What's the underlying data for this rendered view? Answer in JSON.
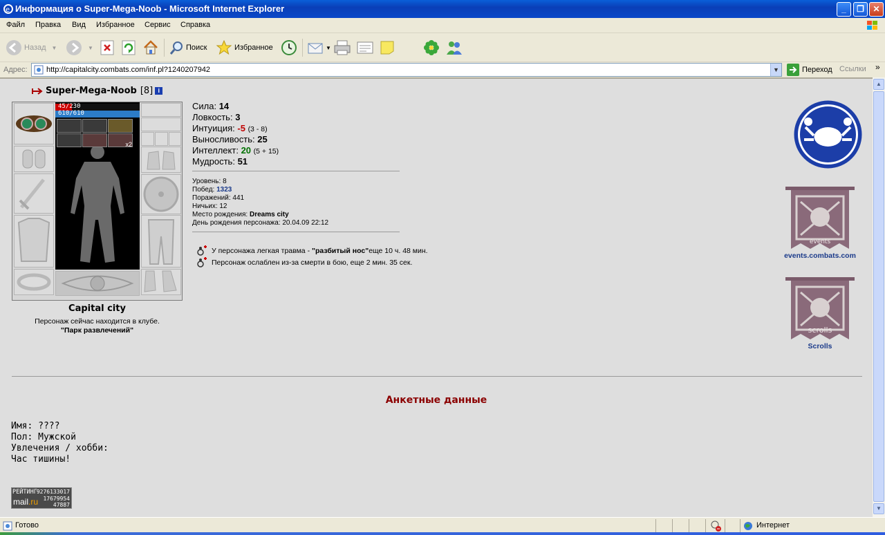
{
  "window": {
    "title": "Информация о Super-Mega-Noob - Microsoft Internet Explorer"
  },
  "menu": [
    "Файл",
    "Правка",
    "Вид",
    "Избранное",
    "Сервис",
    "Справка"
  ],
  "toolbar": {
    "back": "Назад",
    "search": "Поиск",
    "favorites": "Избранное"
  },
  "address": {
    "label": "Адрес:",
    "url": "http://capitalcity.combats.com/inf.pl?1240207942",
    "go": "Переход",
    "links": "Ссылки"
  },
  "character": {
    "name": "Super-Mega-Noob",
    "level": "[8]",
    "hp": "45/230",
    "hp_fraction": 0.196,
    "mp": "610/610",
    "potion_count": "x2",
    "city": "Capital city",
    "club_line": "Персонаж сейчас находится в клубе.",
    "club_name": "\"Парк развлечений\""
  },
  "stats": [
    {
      "label": "Сила:",
      "value": "14",
      "extra": "",
      "tone": ""
    },
    {
      "label": "Ловкость:",
      "value": "3",
      "extra": "",
      "tone": ""
    },
    {
      "label": "Интуиция:",
      "value": "-5",
      "extra": "(3 - 8)",
      "tone": "neg"
    },
    {
      "label": "Выносливость:",
      "value": "25",
      "extra": "",
      "tone": ""
    },
    {
      "label": "Интеллект:",
      "value": "20",
      "extra": "(5 + 15)",
      "tone": "pos"
    },
    {
      "label": "Мудрость:",
      "value": "51",
      "extra": "",
      "tone": ""
    }
  ],
  "records": {
    "level_label": "Уровень:",
    "level": "8",
    "wins_label": "Побед:",
    "wins": "1323",
    "losses_label": "Поражений:",
    "losses": "441",
    "draws_label": "Ничьих:",
    "draws": "12",
    "birthplace_label": "Место рождения:",
    "birthplace": "Dreams city",
    "birthday_label": "День рождения персонажа:",
    "birthday": "20.04.09 22:12"
  },
  "effects": {
    "injury_prefix": "У персонажа легкая травма - ",
    "injury_name": "\"разбитый нос\"",
    "injury_suffix": " еще 10 ч. 48 мин.",
    "weakness": "Персонаж ослаблен из-за смерти в бою, еще 2 мин. 35 сек."
  },
  "sidebar": {
    "events_banner_text": "events",
    "events_link": "events.combats.com",
    "scrolls_banner_text": "scrolls",
    "scrolls_link": "Scrolls"
  },
  "profile": {
    "title": "Анкетные данные",
    "name_row": "Имя: ????",
    "gender_row": "Пол: Мужской",
    "hobby_row": "Увлечения / хобби:",
    "hobby_text": "Час тишины!"
  },
  "counter": {
    "rating": "РЕЙТИНГ",
    "n1": "9276133017",
    "n2": "17679954",
    "n3": "47887",
    "logo": "mail",
    "logo_ru": ".ru"
  },
  "status": {
    "text": "Готово",
    "zone": "Интернет"
  },
  "colors": {
    "negative": "#c00000",
    "positive": "#007000",
    "profile_title": "#8b0000",
    "link": "#1a3a8a"
  }
}
